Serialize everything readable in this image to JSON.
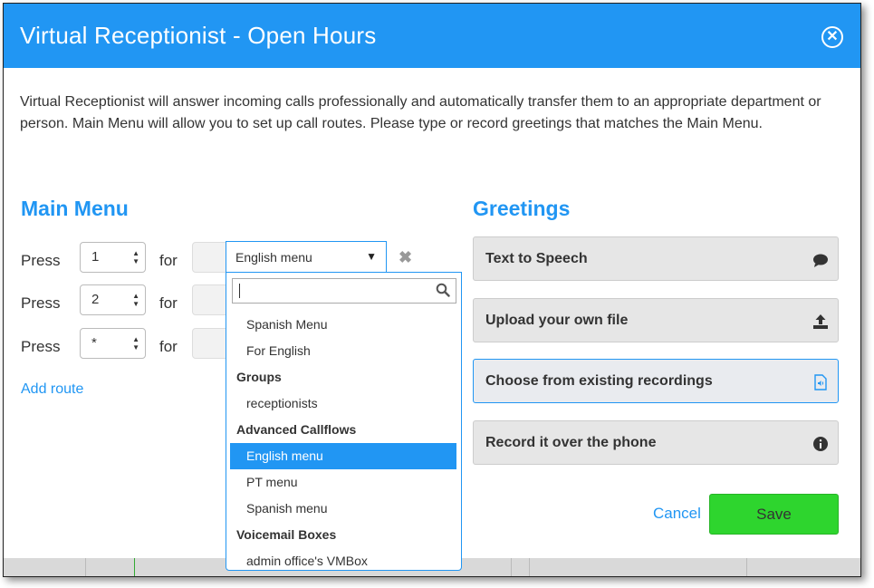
{
  "dialog": {
    "title": "Virtual Receptionist - Open Hours",
    "intro": "Virtual Receptionist will answer incoming calls professionally and automatically transfer them to an appropriate department or person. Main Menu will allow you to set up call routes. Please type or record greetings that matches the Main Menu.",
    "close_icon": "close-circle-icon"
  },
  "main_menu": {
    "title": "Main Menu",
    "routes": [
      {
        "press_label": "Press",
        "key": "1",
        "for_label": "for",
        "target": "English menu"
      },
      {
        "press_label": "Press",
        "key": "2",
        "for_label": "for",
        "target": ""
      },
      {
        "press_label": "Press",
        "key": "*",
        "for_label": "for",
        "target": ""
      }
    ],
    "add_route": "Add route"
  },
  "dropdown": {
    "search_value": "",
    "items": [
      {
        "type": "option",
        "label": "Spanish Menu"
      },
      {
        "type": "option",
        "label": "For English"
      },
      {
        "type": "group",
        "label": "Groups"
      },
      {
        "type": "option",
        "label": "receptionists"
      },
      {
        "type": "group",
        "label": "Advanced Callflows"
      },
      {
        "type": "option",
        "label": "English menu",
        "selected": true
      },
      {
        "type": "option",
        "label": "PT menu"
      },
      {
        "type": "option",
        "label": "Spanish menu"
      },
      {
        "type": "group",
        "label": "Voicemail Boxes"
      },
      {
        "type": "option",
        "label": "admin office's VMBox"
      }
    ]
  },
  "greetings": {
    "title": "Greetings",
    "options": [
      {
        "label": "Text to Speech",
        "icon": "speech-bubble-icon"
      },
      {
        "label": "Upload your own file",
        "icon": "upload-icon"
      },
      {
        "label": "Choose from existing recordings",
        "icon": "audio-file-icon",
        "active": true
      },
      {
        "label": "Record it over the phone",
        "icon": "info-icon"
      }
    ]
  },
  "footer": {
    "cancel": "Cancel",
    "save": "Save"
  },
  "colors": {
    "accent": "#2196f3",
    "save": "#2ed52e"
  }
}
